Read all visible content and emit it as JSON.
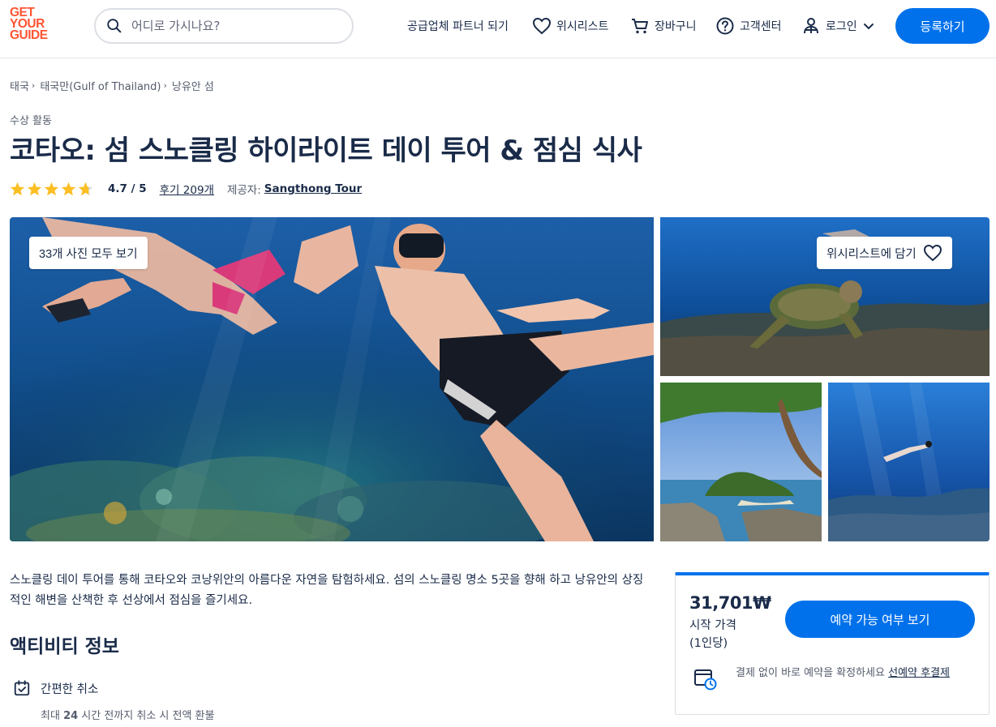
{
  "header": {
    "logo_lines": [
      "GET",
      "YOUR",
      "GUIDE"
    ],
    "search_placeholder": "어디로 가시나요?",
    "nav": {
      "supplier": "공급업체 파트너 되기",
      "wishlist": "위시리스트",
      "cart": "장바구니",
      "help": "고객센터",
      "login": "로그인"
    },
    "signup_label": "등록하기",
    "accent_color": "#0071eb",
    "brand_color": "#ff5533"
  },
  "breadcrumb": [
    "태국",
    "태국만(Gulf of Thailand)",
    "낭유안 섬"
  ],
  "category": "수상 활동",
  "title": "코타오: 섬 스노클링 하이라이트 데이 투어 & 점심 식사",
  "rating": {
    "stars_value": 4.7,
    "value_label": "4.7 / 5",
    "reviews_label": "후기 209개",
    "provider_label": "제공자:",
    "provider_name": "Sangthong Tour"
  },
  "gallery": {
    "photos_button": "33개 사진 모두 보기",
    "wishlist_button": "위시리스트에 담기"
  },
  "description": "스노클링 데이 투어를 통해 코타오와 코낭위안의 아름다운 자연을 탐험하세요. 섬의 스노클링 명소 5곳을 향해 하고 낭유안의 상징적인 해변을 산책한 후 선상에서 점심을 즐기세요.",
  "activity_info": {
    "title": "액티비티 정보",
    "cancel_title": "간편한 취소",
    "cancel_sub_prefix": "최대 ",
    "cancel_sub_bold": "24",
    "cancel_sub_suffix": " 시간 전까지 취소 시 전액 환불"
  },
  "booking": {
    "price": "31,701₩",
    "price_from": "시작 가격",
    "price_per": "(1인당)",
    "check_button": "예약 가능 여부 보기",
    "reserve_text": "결제 없이 바로 예약을 확정하세요 ",
    "reserve_link": "선예약 후결제"
  }
}
